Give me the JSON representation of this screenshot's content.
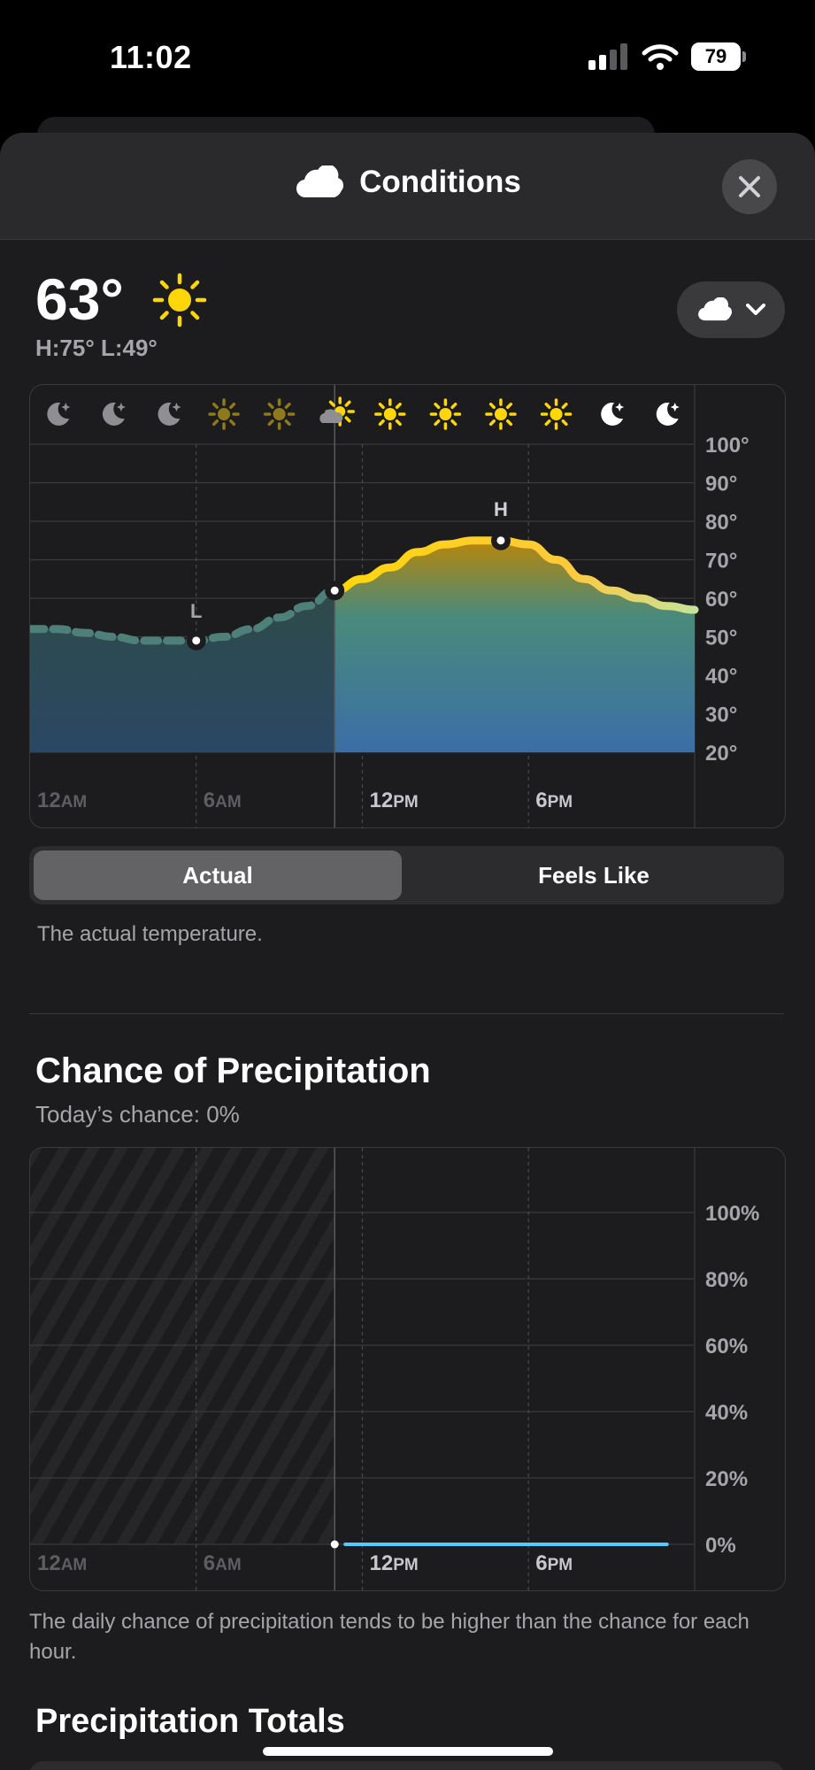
{
  "status_bar": {
    "time": "11:02",
    "battery": "79"
  },
  "header": {
    "title": "Conditions",
    "icon": "cloud-icon",
    "close_icon": "close-icon"
  },
  "current": {
    "temperature": "63°",
    "icon": "sun-icon",
    "hi_lo": "H:75° L:49°",
    "dropdown_icon": "cloud-icon"
  },
  "temperature_chart": {
    "chart_data": {
      "type": "area",
      "hour_icons": [
        "moon",
        "moon",
        "moon",
        "sun-dim",
        "sun-dim",
        "partly-cloudy",
        "sun",
        "sun",
        "sun",
        "sun",
        "moon",
        "moon"
      ],
      "x_labels": [
        "12AM",
        "6AM",
        "12PM",
        "6PM"
      ],
      "y_labels": [
        "100°",
        "90°",
        "80°",
        "70°",
        "60°",
        "50°",
        "40°",
        "30°",
        "20°"
      ],
      "ylim": [
        20,
        100
      ],
      "points_hours": [
        0,
        1,
        2,
        3,
        4,
        5,
        6,
        7,
        8,
        9,
        10,
        11,
        12,
        13,
        14,
        15,
        16,
        17,
        18,
        19,
        20,
        21,
        22,
        23,
        24
      ],
      "points_temps": [
        52,
        52,
        51,
        50,
        49,
        49,
        49,
        50,
        52,
        55,
        58,
        62,
        65,
        68,
        72,
        74,
        75,
        75,
        74,
        70,
        65,
        62,
        60,
        58,
        57
      ],
      "now_hour": 11,
      "low": {
        "label": "L",
        "hour": 6,
        "temp": 49
      },
      "high": {
        "label": "H",
        "hour": 17,
        "temp": 75
      }
    }
  },
  "segmented": {
    "actual": "Actual",
    "feels_like": "Feels Like"
  },
  "description": "The actual temperature.",
  "precipitation": {
    "title": "Chance of Precipitation",
    "subtitle": "Today’s chance: 0%",
    "chart_data": {
      "type": "line",
      "x_labels": [
        "12AM",
        "6AM",
        "12PM",
        "6PM"
      ],
      "y_labels": [
        "100%",
        "80%",
        "60%",
        "40%",
        "20%",
        "0%"
      ],
      "ylim": [
        0,
        100
      ],
      "hours": [
        11,
        12,
        13,
        14,
        15,
        16,
        17,
        18,
        19,
        20,
        21,
        22,
        23
      ],
      "values": [
        0,
        0,
        0,
        0,
        0,
        0,
        0,
        0,
        0,
        0,
        0,
        0,
        0
      ]
    },
    "note": "The daily chance of precipitation tends to be higher than the chance for each hour."
  },
  "totals": {
    "title": "Precipitation Totals"
  },
  "colors": {
    "sun": "#ffd60a",
    "gradient_top": "#ffcc00",
    "area_bottom": "#3b6ea8",
    "line_past": "#4e7f78",
    "precip_line": "#5ac8fa"
  }
}
